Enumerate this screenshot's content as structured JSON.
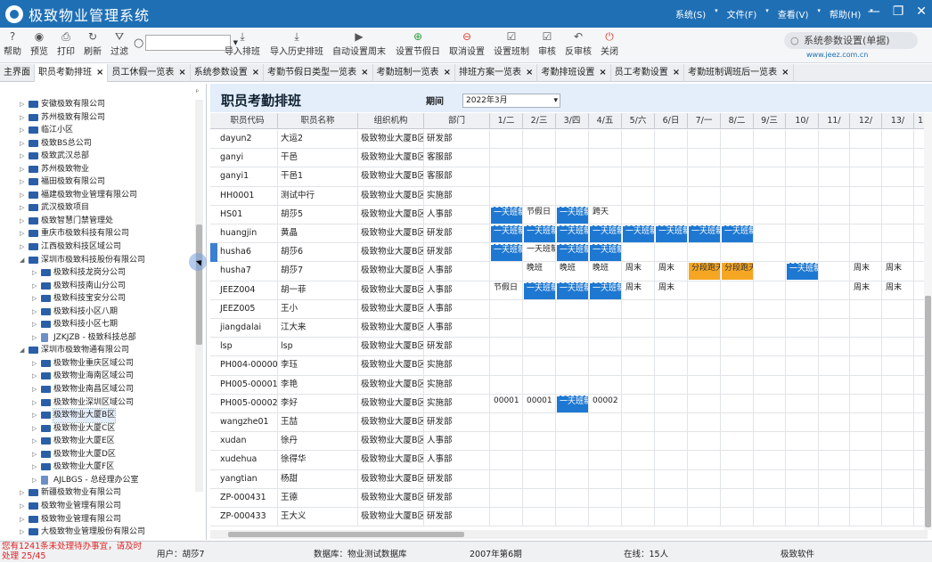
{
  "app": {
    "title": "极致物业管理系统",
    "menus": [
      "系统(S)",
      "文件(F)",
      "查看(V)",
      "帮助(H)"
    ]
  },
  "toolbar": {
    "left": [
      {
        "label": "帮助",
        "icon": "?"
      },
      {
        "label": "预览",
        "icon": "◉"
      },
      {
        "label": "打印",
        "icon": "⎙"
      },
      {
        "label": "刷新",
        "icon": "↻"
      },
      {
        "label": "过滤",
        "icon": "⛛"
      }
    ],
    "actions": [
      {
        "label": "导入排班",
        "icon": "⤓"
      },
      {
        "label": "导入历史排班",
        "icon": "⤓"
      },
      {
        "label": "自动设置周末",
        "icon": "▶"
      },
      {
        "label": "设置节假日",
        "icon": "⊕"
      },
      {
        "label": "取消设置",
        "icon": "⊖"
      },
      {
        "label": "设置班制",
        "icon": "☑"
      },
      {
        "label": "审核",
        "icon": "☑"
      },
      {
        "label": "反审核",
        "icon": "↶"
      },
      {
        "label": "关闭",
        "icon": "⏻"
      }
    ],
    "search_value": "",
    "right_search": "系统参数设置(单据)",
    "website": "www.jeez.com.cn"
  },
  "tabs": [
    "主界面",
    "职员考勤排班",
    "员工休假一览表",
    "系统参数设置",
    "考勤节假日类型一览表",
    "考勤班制一览表",
    "排班方案一览表",
    "考勤排班设置",
    "员工考勤设置",
    "考勤班制调班后一览表"
  ],
  "tree": [
    {
      "label": "安徽极致有限公司",
      "level": 1,
      "type": "folder",
      "open": false
    },
    {
      "label": "苏州极致有限公司",
      "level": 1,
      "type": "folder",
      "open": false
    },
    {
      "label": "临江小区",
      "level": 1,
      "type": "folder",
      "open": false
    },
    {
      "label": "极致BS总公司",
      "level": 1,
      "type": "folder",
      "open": false
    },
    {
      "label": "极致武汉总部",
      "level": 1,
      "type": "folder",
      "open": false
    },
    {
      "label": "苏州极致物业",
      "level": 1,
      "type": "folder",
      "open": false
    },
    {
      "label": "福田极致有限公司",
      "level": 1,
      "type": "folder",
      "open": false
    },
    {
      "label": "福建极致物业管理有限公司",
      "level": 1,
      "type": "folder",
      "open": false
    },
    {
      "label": "武汉极致项目",
      "level": 1,
      "type": "folder",
      "open": false
    },
    {
      "label": "极致智慧门禁管理处",
      "level": 1,
      "type": "folder",
      "open": false
    },
    {
      "label": "重庆市极致科技有限公司",
      "level": 1,
      "type": "folder",
      "open": false
    },
    {
      "label": "江西极致科技区域公司",
      "level": 1,
      "type": "folder",
      "open": false
    },
    {
      "label": "深圳市极致科技股份有限公司",
      "level": 1,
      "type": "folder",
      "open": true
    },
    {
      "label": "极致科技龙岗分公司",
      "level": 2,
      "type": "folder",
      "open": false
    },
    {
      "label": "极致科技南山分公司",
      "level": 2,
      "type": "folder",
      "open": false
    },
    {
      "label": "极致科技宝安分公司",
      "level": 2,
      "type": "folder",
      "open": false
    },
    {
      "label": "极致科技小区八期",
      "level": 2,
      "type": "folder",
      "open": false
    },
    {
      "label": "极致科技小区七期",
      "level": 2,
      "type": "folder",
      "open": false
    },
    {
      "label": "JZKJZB - 极致科技总部",
      "level": 2,
      "type": "page",
      "open": false
    },
    {
      "label": "深圳市极致物通有限公司",
      "level": 1,
      "type": "folder",
      "open": true
    },
    {
      "label": "极致物业重庆区域公司",
      "level": 2,
      "type": "folder",
      "open": false
    },
    {
      "label": "极致物业海南区域公司",
      "level": 2,
      "type": "folder",
      "open": false
    },
    {
      "label": "极致物业南昌区域公司",
      "level": 2,
      "type": "folder",
      "open": false
    },
    {
      "label": "极致物业深圳区域公司",
      "level": 2,
      "type": "folder",
      "open": false
    },
    {
      "label": "极致物业大厦B区",
      "level": 2,
      "type": "folder",
      "open": false,
      "selected": true
    },
    {
      "label": "极致物业大厦C区",
      "level": 2,
      "type": "folder",
      "open": false
    },
    {
      "label": "极致物业大厦E区",
      "level": 2,
      "type": "folder",
      "open": false
    },
    {
      "label": "极致物业大厦D区",
      "level": 2,
      "type": "folder",
      "open": false
    },
    {
      "label": "极致物业大厦F区",
      "level": 2,
      "type": "folder",
      "open": false
    },
    {
      "label": "AJLBGS - 总经理办公室",
      "level": 2,
      "type": "page",
      "open": false
    },
    {
      "label": "新疆极致物业有限公司",
      "level": 1,
      "type": "folder",
      "open": false
    },
    {
      "label": "极致物业管理有限公司",
      "level": 1,
      "type": "folder",
      "open": false
    },
    {
      "label": "极致物业管理有限公司",
      "level": 1,
      "type": "folder",
      "open": false
    },
    {
      "label": "大极致物业管理股份有限公司",
      "level": 1,
      "type": "folder",
      "open": false
    }
  ],
  "page": {
    "title": "职员考勤排班",
    "period_label": "期间",
    "period_value": "2022年3月"
  },
  "grid": {
    "columns": [
      "职员代码",
      "职员名称",
      "组织机构",
      "部门",
      "1/二",
      "2/三",
      "3/四",
      "4/五",
      "5/六",
      "6/日",
      "7/一",
      "8/二",
      "9/三",
      "10/",
      "11/",
      "12/",
      "13/",
      "1"
    ],
    "colors": {
      "blue": "#1e78d2",
      "orange": "#f5a623"
    },
    "rows": [
      {
        "code": "dayun2",
        "name": "大运2",
        "org": "极致物业大厦B区",
        "dept": "研发部",
        "cells": []
      },
      {
        "code": "ganyi",
        "name": "干邑",
        "org": "极致物业大厦B区",
        "dept": "客服部",
        "cells": []
      },
      {
        "code": "ganyi1",
        "name": "干邑1",
        "org": "极致物业大厦B区",
        "dept": "客服部",
        "cells": []
      },
      {
        "code": "HH0001",
        "name": "测试中行",
        "org": "极致物业大厦B区",
        "dept": "实施部",
        "cells": []
      },
      {
        "code": "HS01",
        "name": "胡莎5",
        "org": "极致物业大厦B区",
        "dept": "人事部",
        "cells": [
          {
            "d": 0,
            "t": "一天班制",
            "s": "b"
          },
          {
            "d": 1,
            "t": "节假日",
            "s": "w"
          },
          {
            "d": 2,
            "t": "一天班制",
            "s": "b"
          },
          {
            "d": 3,
            "t": "跨天",
            "s": "w"
          }
        ]
      },
      {
        "code": "huangjin",
        "name": "黄晶",
        "org": "极致物业大厦B区",
        "dept": "研发部",
        "cells": [
          {
            "d": 0,
            "t": "一天班制",
            "s": "b"
          },
          {
            "d": 1,
            "t": "一天班制",
            "s": "b"
          },
          {
            "d": 2,
            "t": "一天班制",
            "s": "b"
          },
          {
            "d": 3,
            "t": "一天班制",
            "s": "b"
          },
          {
            "d": 4,
            "t": "一天班制",
            "s": "b"
          },
          {
            "d": 5,
            "t": "一天班制",
            "s": "b"
          },
          {
            "d": 6,
            "t": "一天班制",
            "s": "b"
          },
          {
            "d": 7,
            "t": "一天班制",
            "s": "b"
          }
        ]
      },
      {
        "code": "husha6",
        "name": "胡莎6",
        "org": "极致物业大厦B区",
        "dept": "研发部",
        "marked": true,
        "cells": [
          {
            "d": 0,
            "t": "一天班制",
            "s": "b"
          },
          {
            "d": 1,
            "t": "一天班制",
            "s": "w"
          },
          {
            "d": 2,
            "t": "一天班制",
            "s": "b"
          },
          {
            "d": 3,
            "t": "一天班制",
            "s": "b"
          }
        ]
      },
      {
        "code": "husha7",
        "name": "胡莎7",
        "org": "极致物业大厦B区",
        "dept": "人事部",
        "cells": [
          {
            "d": 1,
            "t": "晚班",
            "s": "w"
          },
          {
            "d": 2,
            "t": "晚班",
            "s": "w"
          },
          {
            "d": 3,
            "t": "晚班",
            "s": "w"
          },
          {
            "d": 4,
            "t": "周末",
            "s": "w"
          },
          {
            "d": 5,
            "t": "周末",
            "s": "w"
          },
          {
            "d": 6,
            "t": "分段跑天",
            "s": "o"
          },
          {
            "d": 7,
            "t": "分段跑天",
            "s": "o"
          },
          {
            "d": 9,
            "t": "一天班制",
            "s": "b"
          },
          {
            "d": 11,
            "t": "周末",
            "s": "w"
          },
          {
            "d": 12,
            "t": "周末",
            "s": "w"
          }
        ]
      },
      {
        "code": "JEEZ004",
        "name": "胡一菲",
        "org": "极致物业大厦B区",
        "dept": "人事部",
        "cells": [
          {
            "d": 0,
            "t": "节假日",
            "s": "w"
          },
          {
            "d": 1,
            "t": "一天班制",
            "s": "b"
          },
          {
            "d": 2,
            "t": "一天班制",
            "s": "b"
          },
          {
            "d": 3,
            "t": "一天班制",
            "s": "b"
          },
          {
            "d": 4,
            "t": "周末",
            "s": "w"
          },
          {
            "d": 5,
            "t": "周末",
            "s": "w"
          },
          {
            "d": 11,
            "t": "周末",
            "s": "w"
          },
          {
            "d": 12,
            "t": "周末",
            "s": "w"
          }
        ]
      },
      {
        "code": "JEEZ005",
        "name": "王小",
        "org": "极致物业大厦B区",
        "dept": "人事部",
        "cells": []
      },
      {
        "code": "jiangdalai",
        "name": "江大来",
        "org": "极致物业大厦B区",
        "dept": "人事部",
        "cells": []
      },
      {
        "code": "lsp",
        "name": "lsp",
        "org": "极致物业大厦B区",
        "dept": "研发部",
        "cells": []
      },
      {
        "code": "PH004-000002",
        "name": "李珏",
        "org": "极致物业大厦B区",
        "dept": "实施部",
        "cells": []
      },
      {
        "code": "PH005-000015",
        "name": "李艳",
        "org": "极致物业大厦B区",
        "dept": "实施部",
        "cells": []
      },
      {
        "code": "PH005-000020",
        "name": "李好",
        "org": "极致物业大厦B区",
        "dept": "实施部",
        "cells": [
          {
            "d": 0,
            "t": "00001",
            "s": "w"
          },
          {
            "d": 1,
            "t": "00001",
            "s": "w"
          },
          {
            "d": 2,
            "t": "一天班制",
            "s": "b"
          },
          {
            "d": 3,
            "t": "00002",
            "s": "w"
          }
        ]
      },
      {
        "code": "wangzhe01",
        "name": "王喆",
        "org": "极致物业大厦B区",
        "dept": "研发部",
        "cells": []
      },
      {
        "code": "xudan",
        "name": "徐丹",
        "org": "极致物业大厦B区",
        "dept": "人事部",
        "cells": []
      },
      {
        "code": "xudehua",
        "name": "徐得华",
        "org": "极致物业大厦B区",
        "dept": "人事部",
        "cells": []
      },
      {
        "code": "yangtian",
        "name": "杨甜",
        "org": "极致物业大厦B区",
        "dept": "研发部",
        "cells": []
      },
      {
        "code": "ZP-000431",
        "name": "王德",
        "org": "极致物业大厦B区",
        "dept": "研发部",
        "cells": []
      },
      {
        "code": "ZP-000433",
        "name": "王大义",
        "org": "极致物业大厦B区",
        "dept": "研发部",
        "cells": []
      }
    ]
  },
  "status": {
    "warning": "您有1241条未处理待办事宜，请及时处理",
    "pager": "25/45",
    "user": "用户：胡莎7",
    "database": "数据库：物业测试数据库",
    "period": "2007年第6期",
    "online": "在线：15人",
    "brand": "极致软件"
  }
}
